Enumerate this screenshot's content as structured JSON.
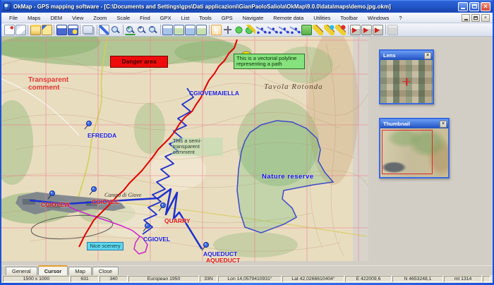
{
  "window": {
    "title": "OkMap - GPS mapping software - [C:\\Documents and Settings\\gps\\Dati applicazioni\\GianPaoloSaliola\\OkMap\\9.0.0\\data\\maps\\demo.jpg.okm]"
  },
  "menu": {
    "items": [
      "File",
      "Maps",
      "DEM",
      "View",
      "Zoom",
      "Scale",
      "Find",
      "GPX",
      "List",
      "Tools",
      "GPS",
      "Navigate",
      "Remote data",
      "Utilities",
      "Toolbar",
      "Windows",
      "?"
    ]
  },
  "toolbar": {
    "icons": [
      "new-map",
      "open-map",
      "import-map",
      "export-map",
      "save-map",
      "map-scale",
      "copy-map",
      "map-properties",
      "find-map",
      "zoom-original",
      "zoom-in",
      "zoom-out",
      "zoom-window",
      "zoom-region",
      "zoom-full",
      "zoom-previous",
      "pointer-tool",
      "pan-tool",
      "add-waypoint",
      "edit-waypoint",
      "add-route",
      "edit-route",
      "add-track",
      "edit-track",
      "add-area",
      "new-comment",
      "edit-comment",
      "delete-comment",
      "send-waypoints",
      "send-routes",
      "send-tracks",
      "properties"
    ]
  },
  "map": {
    "comments": {
      "danger": "Danger area",
      "vector_polyline": "This is a vectorial polyline representing a path",
      "transparent": "Transparent comment",
      "semi_transparent": "This a semi-transparent comment",
      "nice_scenery": "Nice scenery"
    },
    "waypoints": {
      "cgiovemaiella": "CGIOVEMAIELLA",
      "efredda": "EFREDDA",
      "cgiovew": "CGIOVEW",
      "cgiovec": "CGIOVEC",
      "quarry": "QUARRY",
      "cgiovel": "CGIOVEL",
      "aqueduct_blue": "AQUEDUCT",
      "aqueduct_red": "AQUEDUCT"
    },
    "areas": {
      "nature_reserve": "Nature reserve"
    },
    "place_names": {
      "tavola_rotonda": "Tavola Rotonda",
      "campo_di_giove": "Campo di Giove"
    }
  },
  "palettes": {
    "lens": {
      "title": "Lens"
    },
    "thumbnail": {
      "title": "Thumbnail"
    }
  },
  "tabs": {
    "items": [
      "General",
      "Cursor",
      "Map",
      "Close"
    ]
  },
  "statusbar": {
    "cells": [
      "1500 x 1000",
      "631",
      "340",
      "European 1950",
      "33N",
      "Lon 14,0579410931°",
      "Lat 42,0266610404°",
      "E 422009,6",
      "N 4653248,1",
      "mt 1314"
    ]
  }
}
